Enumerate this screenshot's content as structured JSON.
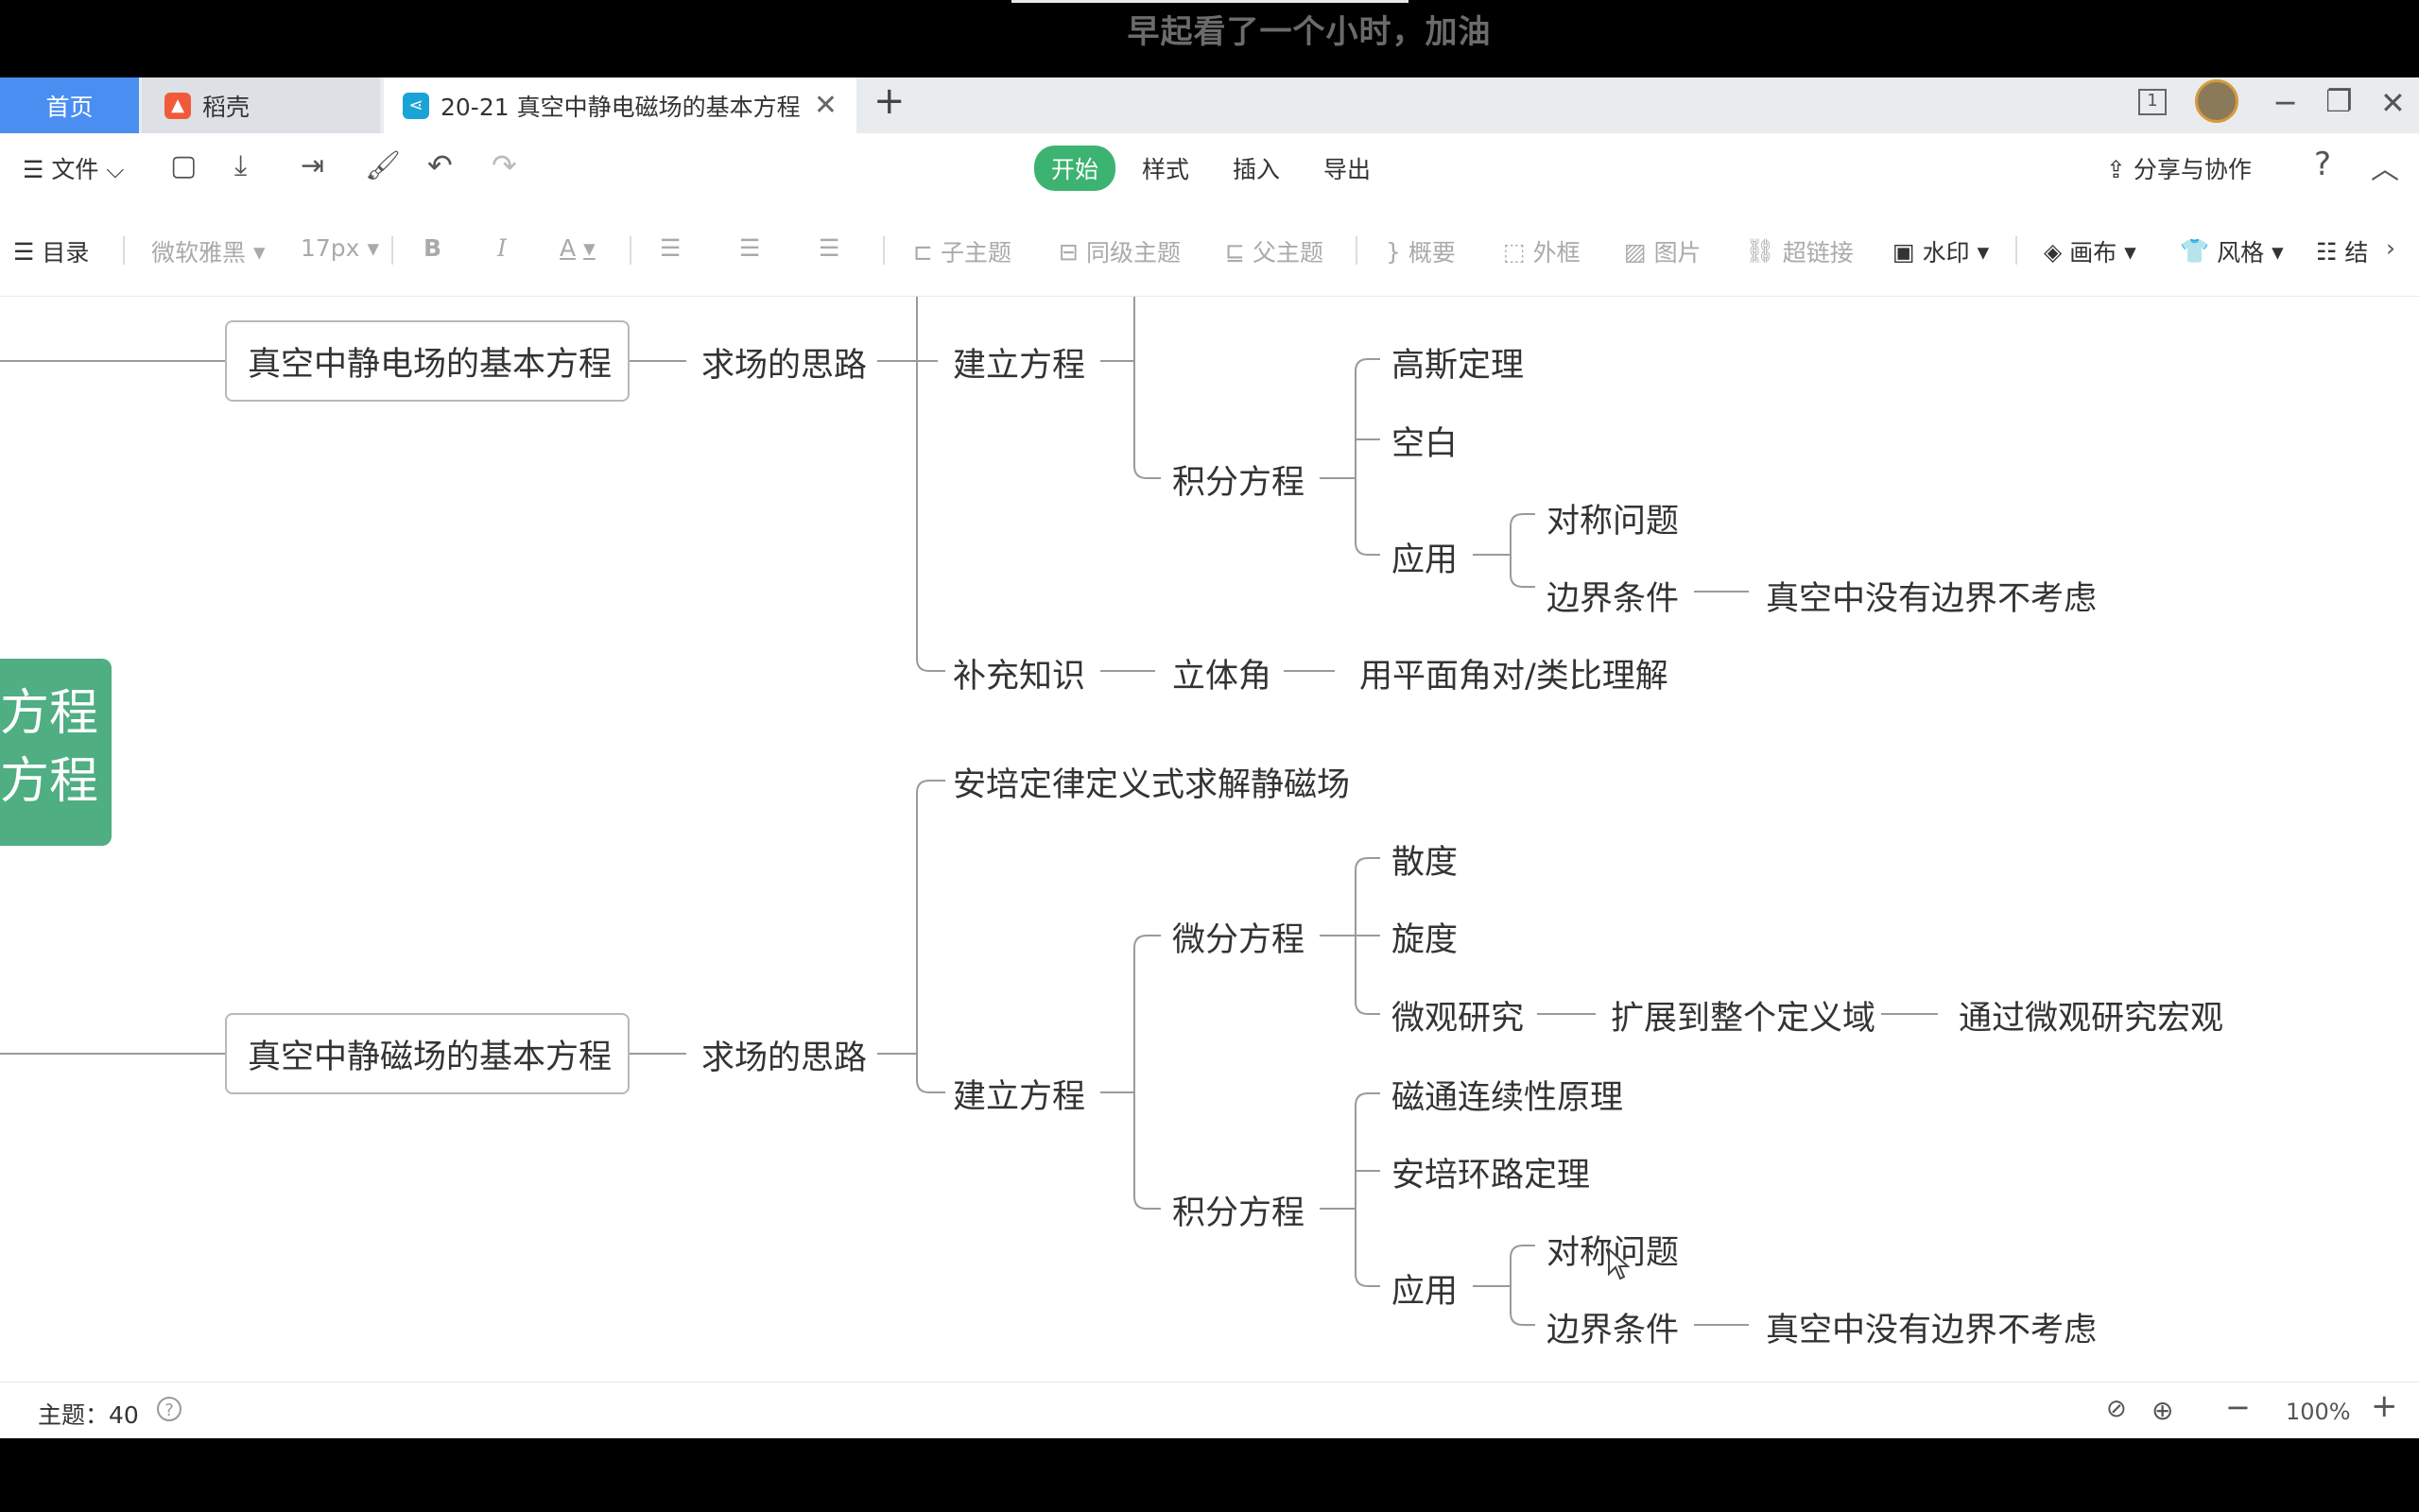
{
  "caption": "早起看了一个小时，加油",
  "tabs": {
    "home": "首页",
    "daoke": "稻壳",
    "doc": "20-21 真空中静电磁场的基本方程"
  },
  "window": {
    "page_badge": "1"
  },
  "menu": {
    "file": "文件",
    "tabs": [
      "开始",
      "样式",
      "插入",
      "导出"
    ],
    "share": "分享与协作",
    "help": "?"
  },
  "toolbar": {
    "toc": "目录",
    "font": "微软雅黑",
    "size": "17px",
    "bold": "B",
    "italic": "I",
    "color": "A",
    "subtopic": "子主题",
    "sibling": "同级主题",
    "parent": "父主题",
    "summary": "概要",
    "frame": "外框",
    "image": "图片",
    "link": "超链接",
    "watermark": "水印",
    "canvas": "画布",
    "style": "风格",
    "structure": "结"
  },
  "mindmap": {
    "root_lines": [
      "方程",
      "方程"
    ],
    "electric": {
      "title": "真空中静电场的基本方程",
      "idea": "求场的思路",
      "build": "建立方程",
      "integral": "积分方程",
      "gauss": "高斯定理",
      "blank": "空白",
      "apply": "应用",
      "symmetry": "对称问题",
      "boundary": "边界条件",
      "no_boundary": "真空中没有边界不考虑",
      "supplement": "补充知识",
      "solid_angle": "立体角",
      "analogy": "用平面角对/类比理解"
    },
    "magnetic": {
      "title": "真空中静磁场的基本方程",
      "idea": "求场的思路",
      "ampere_def": "安培定律定义式求解静磁场",
      "build": "建立方程",
      "differential": "微分方程",
      "divergence": "散度",
      "curl": "旋度",
      "micro": "微观研究",
      "extend": "扩展到整个定义域",
      "macro": "通过微观研究宏观",
      "integral": "积分方程",
      "flux": "磁通连续性原理",
      "ampere_loop": "安培环路定理",
      "apply": "应用",
      "symmetry": "对称问题",
      "boundary": "边界条件",
      "no_boundary": "真空中没有边界不考虑"
    }
  },
  "status": {
    "topics": "主题：40",
    "zoom": "100%"
  }
}
